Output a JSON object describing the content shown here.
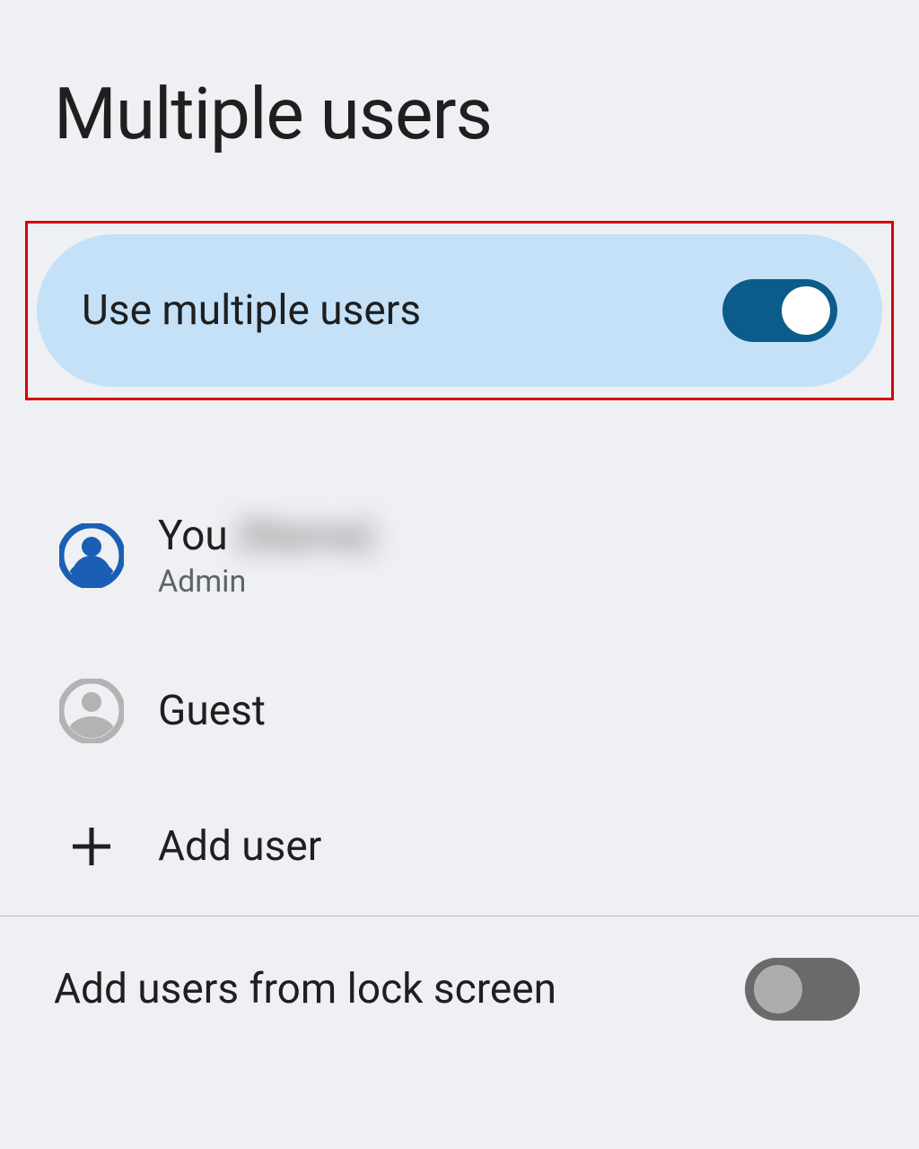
{
  "page": {
    "title": "Multiple users"
  },
  "toggle": {
    "label": "Use multiple users",
    "value": true
  },
  "users": [
    {
      "name": "You",
      "blurredName": "(Name)",
      "role": "Admin",
      "iconColor": "#1a5fb4",
      "isCurrent": true
    },
    {
      "name": "Guest",
      "iconColor": "#b3b3b3",
      "isCurrent": false
    }
  ],
  "addUser": {
    "label": "Add user"
  },
  "lockScreen": {
    "label": "Add users from lock screen",
    "value": false
  }
}
